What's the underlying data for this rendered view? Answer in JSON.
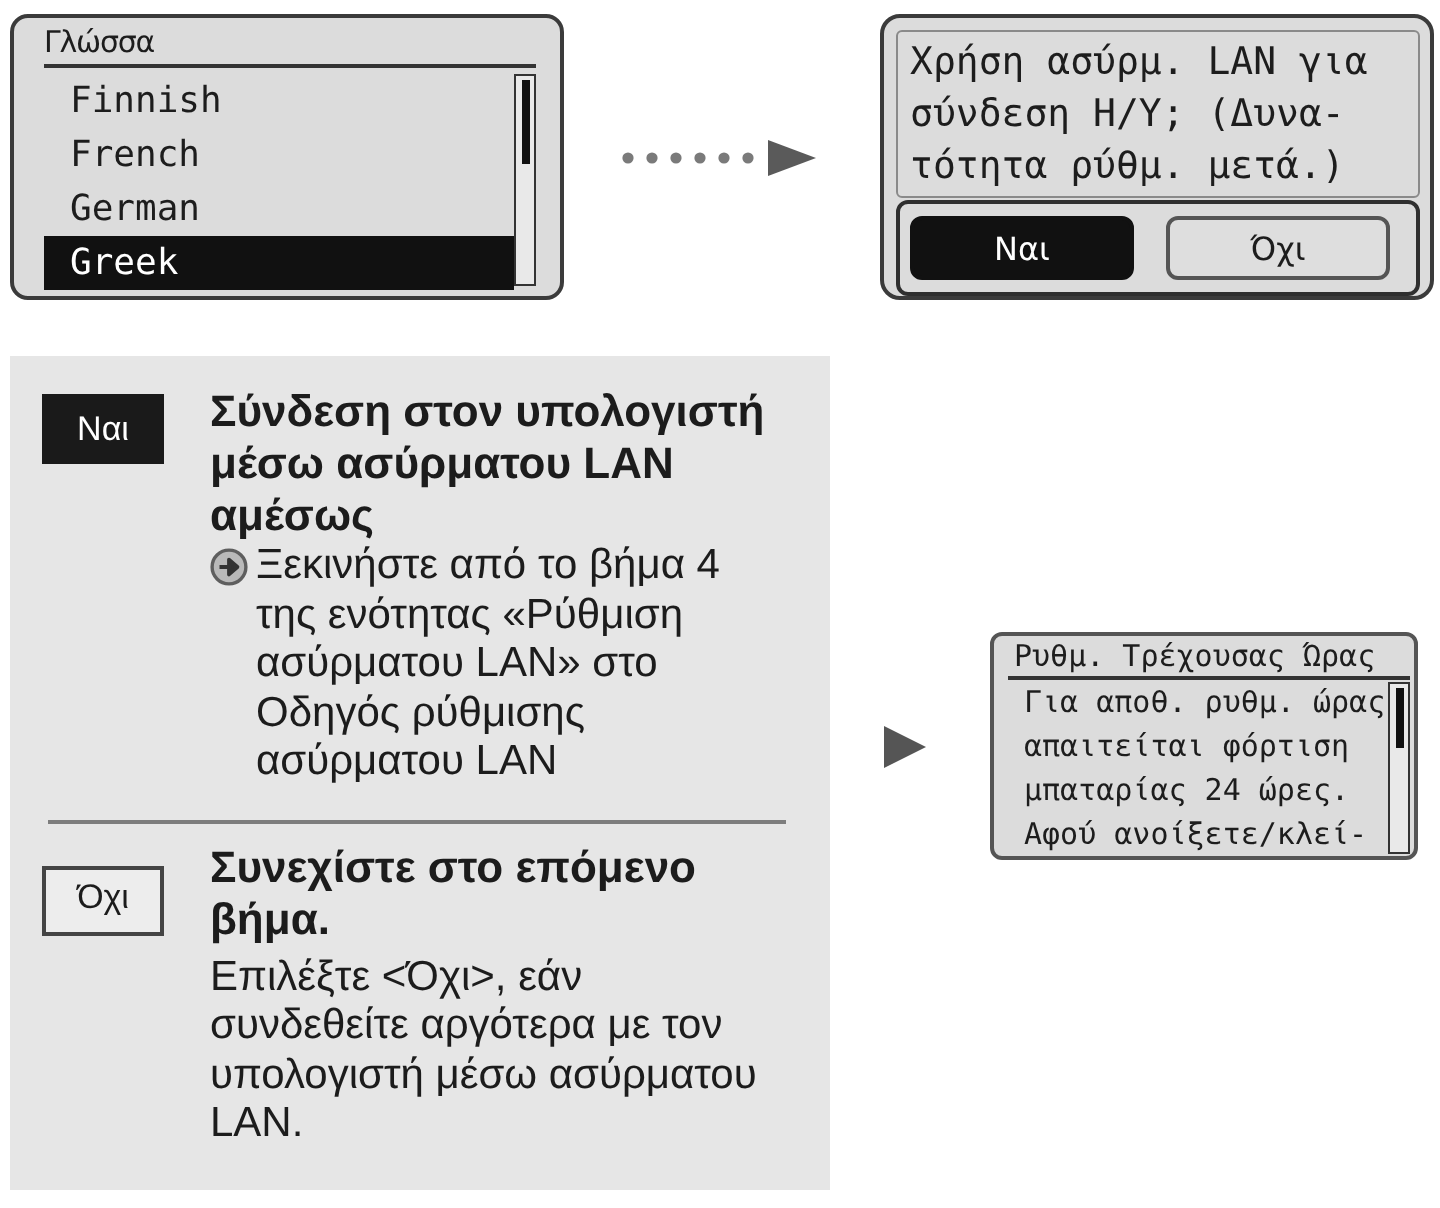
{
  "language_screen": {
    "title": "Γλώσσα",
    "items": [
      {
        "label": "Finnish",
        "selected": false
      },
      {
        "label": "French",
        "selected": false
      },
      {
        "label": "German",
        "selected": false
      },
      {
        "label": "Greek",
        "selected": true
      }
    ]
  },
  "confirm_screen": {
    "message": "Χρήση ασύρμ. LAN για σύνδεση Η/Υ; (Δυνα- τότητα ρύθμ. μετά.)",
    "buttons": [
      {
        "label": "Ναι",
        "selected": true
      },
      {
        "label": "Όχι",
        "selected": false
      }
    ]
  },
  "options": [
    {
      "key": {
        "label": "Ναι",
        "kind": "filled"
      },
      "heading": "Σύνδεση στον υπολογιστή μέσω ασύρματου LAN αμέσως",
      "detail": {
        "kind": "reference",
        "text": "Ξεκινήστε από το βήμα 4 της ενότητας «Ρύθμιση ασύρματου LAN» στο Οδηγός ρύθμισης ασύρματου LAN"
      }
    },
    {
      "key": {
        "label": "Όχι",
        "kind": "outlined"
      },
      "heading": "Συνεχίστε στο επόμενο βήμα.",
      "detail": {
        "kind": "plain",
        "text": "Επιλέξτε <Όχι>, εάν συνδεθείτε αργότερα με τον υπολογιστή μέσω ασύρματου LAN."
      }
    }
  ],
  "time_screen": {
    "title": "Ρυθμ. Τρέχουσας Ώρας",
    "message": "Για αποθ. ρυθμ. ώρας απαιτείται φόρτιση μπαταρίας 24 ώρες. Αφού ανοίξετε/κλεί-"
  }
}
